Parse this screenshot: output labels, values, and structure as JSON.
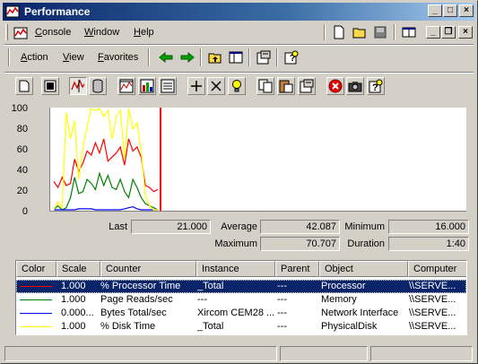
{
  "window": {
    "title": "Performance"
  },
  "menu": [
    {
      "label": "Console",
      "u": "C",
      "rest": "onsole"
    },
    {
      "label": "Window",
      "u": "W",
      "rest": "indow"
    },
    {
      "label": "Help",
      "u": "H",
      "rest": "elp"
    }
  ],
  "action_menu": [
    {
      "label": "Action",
      "u": "A",
      "rest": "ction"
    },
    {
      "label": "View",
      "u": "V",
      "rest": "iew"
    },
    {
      "label": "Favorites",
      "u": "F",
      "rest": "avorites"
    }
  ],
  "chart": {
    "y_ticks": [
      "100",
      "80",
      "60",
      "40",
      "20",
      "0"
    ]
  },
  "chart_data": {
    "type": "line",
    "ylim": [
      0,
      100
    ],
    "series": [
      {
        "name": "% Processor Time",
        "color": "#ff0000",
        "values": [
          28,
          22,
          32,
          24,
          26,
          50,
          38,
          46,
          58,
          54,
          66,
          56,
          70,
          48,
          52,
          56,
          62,
          44,
          70,
          58,
          62,
          52,
          24,
          22,
          18,
          20
        ]
      },
      {
        "name": "Page Reads/sec",
        "color": "#008000",
        "values": [
          0,
          4,
          0,
          2,
          12,
          32,
          16,
          18,
          30,
          26,
          20,
          36,
          24,
          34,
          22,
          20,
          30,
          18,
          12,
          30,
          22,
          12,
          6,
          4,
          2,
          0
        ]
      },
      {
        "name": "Bytes Total/sec",
        "color": "#0000ff",
        "values": [
          0,
          0,
          0,
          0,
          0,
          0,
          1,
          1,
          1,
          1,
          0,
          0,
          0,
          0,
          0,
          0,
          0,
          1,
          2,
          3,
          1,
          0,
          0,
          0,
          0,
          0
        ]
      },
      {
        "name": "% Disk Time",
        "color": "#ffff00",
        "values": [
          0,
          8,
          2,
          96,
          70,
          88,
          30,
          62,
          82,
          100,
          98,
          100,
          92,
          98,
          70,
          92,
          98,
          50,
          100,
          80,
          86,
          58,
          14,
          4,
          0,
          0
        ]
      }
    ]
  },
  "stats": {
    "last_label": "Last",
    "last": "21.000",
    "average_label": "Average",
    "average": "42.087",
    "minimum_label": "Minimum",
    "minimum": "16.000",
    "maximum_label": "Maximum",
    "maximum": "70.707",
    "duration_label": "Duration",
    "duration": "1:40"
  },
  "legend": {
    "headers": [
      "Color",
      "Scale",
      "Counter",
      "Instance",
      "Parent",
      "Object",
      "Computer"
    ],
    "rows": [
      {
        "color": "#ff0000",
        "scale": "1.000",
        "counter": "% Processor Time",
        "instance": "_Total",
        "parent": "---",
        "object": "Processor",
        "computer": "\\\\SERVE..."
      },
      {
        "color": "#008000",
        "scale": "1.000",
        "counter": "Page Reads/sec",
        "instance": "---",
        "parent": "---",
        "object": "Memory",
        "computer": "\\\\SERVE..."
      },
      {
        "color": "#0000ff",
        "scale": "0.000...",
        "counter": "Bytes Total/sec",
        "instance": "Xircom CEM28 ...",
        "parent": "---",
        "object": "Network Interface",
        "computer": "\\\\SERVE..."
      },
      {
        "color": "#ffff00",
        "scale": "1.000",
        "counter": "% Disk Time",
        "instance": "_Total",
        "parent": "---",
        "object": "PhysicalDisk",
        "computer": "\\\\SERVE..."
      }
    ]
  }
}
